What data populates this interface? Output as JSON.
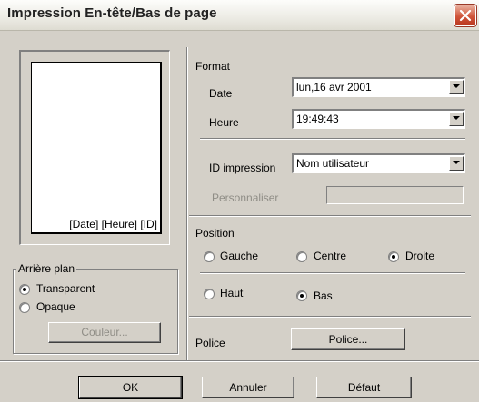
{
  "window": {
    "title": "Impression En-tête/Bas de page"
  },
  "preview": {
    "footer_text": "[Date] [Heure] [ID]"
  },
  "background": {
    "group_label": "Arrière plan",
    "transparent_label": "Transparent",
    "opaque_label": "Opaque",
    "selected": "Transparent",
    "color_button_label": "Couleur..."
  },
  "format": {
    "section_label": "Format",
    "date_label": "Date",
    "date_value": "lun,16 avr 2001",
    "time_label": "Heure",
    "time_value": "19:49:43",
    "id_label": "ID impression",
    "id_value": "Nom utilisateur",
    "custom_label": "Personnaliser",
    "custom_value": ""
  },
  "position": {
    "section_label": "Position",
    "left_label": "Gauche",
    "center_label": "Centre",
    "right_label": "Droite",
    "top_label": "Haut",
    "bottom_label": "Bas",
    "horizontal_selected": "Droite",
    "vertical_selected": "Bas"
  },
  "font": {
    "section_label": "Police",
    "button_label": "Police..."
  },
  "actions": {
    "ok_label": "OK",
    "cancel_label": "Annuler",
    "default_label": "Défaut"
  }
}
